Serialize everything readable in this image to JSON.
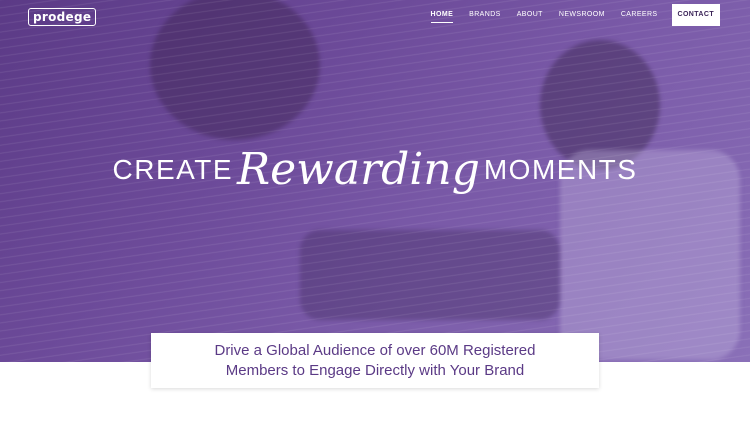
{
  "brand": {
    "logo_text": "prodege"
  },
  "nav": {
    "items": [
      {
        "label": "HOME",
        "active": true
      },
      {
        "label": "BRANDS"
      },
      {
        "label": "ABOUT"
      },
      {
        "label": "NEWSROOM"
      },
      {
        "label": "CAREERS"
      }
    ],
    "contact_label": "CONTACT"
  },
  "hero": {
    "headline_left": "CREATE",
    "headline_script": "Rewarding",
    "headline_right": "MOMENTS"
  },
  "tagline": {
    "line1": "Drive a Global Audience of over 60M Registered",
    "line2": "Members to Engage Directly with Your Brand"
  },
  "colors": {
    "hero_purple": "#5b3a86",
    "text_purple": "#5b3a86",
    "white": "#ffffff"
  }
}
